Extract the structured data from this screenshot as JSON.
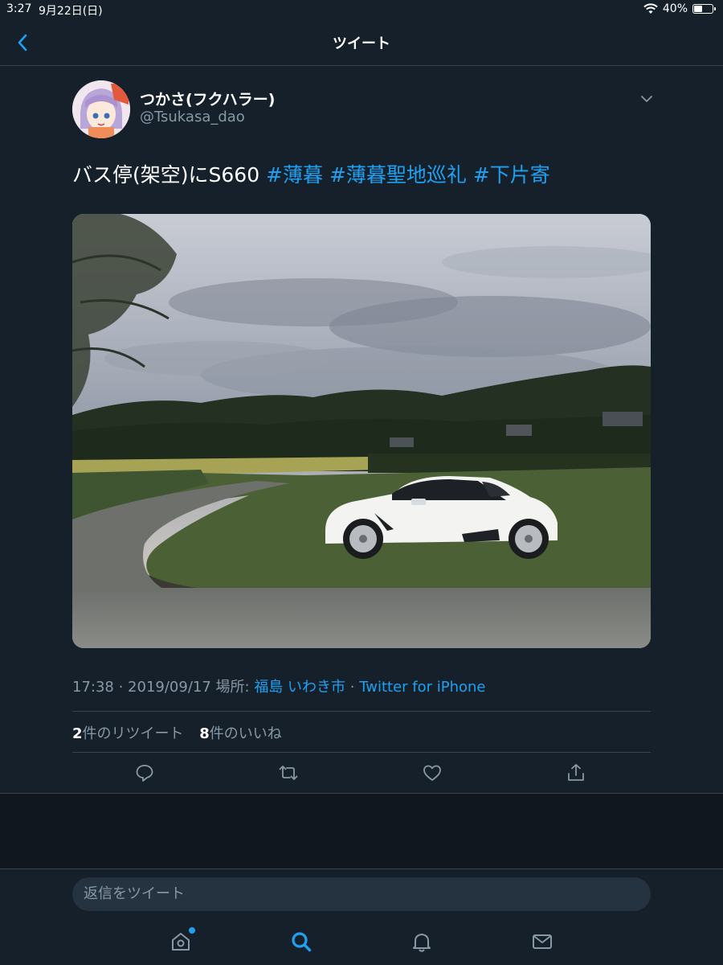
{
  "status_bar": {
    "time": "3:27",
    "date": "9月22日(日)",
    "battery": "40%",
    "battery_level": 0.4
  },
  "nav": {
    "title": "ツイート"
  },
  "tweet": {
    "author": {
      "name": "つかさ(フクハラー)",
      "handle": "@Tsukasa_dao"
    },
    "text": "バス停(架空)にS660 ",
    "hashtags": [
      "#薄暮",
      "#薄暮聖地巡礼",
      "#下片寄"
    ],
    "meta": {
      "time": "17:38",
      "sep1": " · ",
      "date": "2019/09/17",
      "location_label": " 場所: ",
      "location": "福島 いわき市",
      "sep2": " · ",
      "source": "Twitter for iPhone"
    },
    "stats": {
      "retweets_count": "2",
      "retweets_label": "件のリツイート",
      "likes_count": "8",
      "likes_label": "件のいいね"
    }
  },
  "reply": {
    "placeholder": "返信をツイート"
  },
  "colors": {
    "background": "#15202b",
    "accent": "#1da1f2",
    "secondary_text": "#8899a6",
    "divider": "#38444d"
  },
  "icons": [
    "back-chevron-icon",
    "caret-down-icon",
    "reply-icon",
    "retweet-icon",
    "like-icon",
    "share-icon",
    "home-icon",
    "search-icon",
    "notifications-icon",
    "messages-icon"
  ]
}
